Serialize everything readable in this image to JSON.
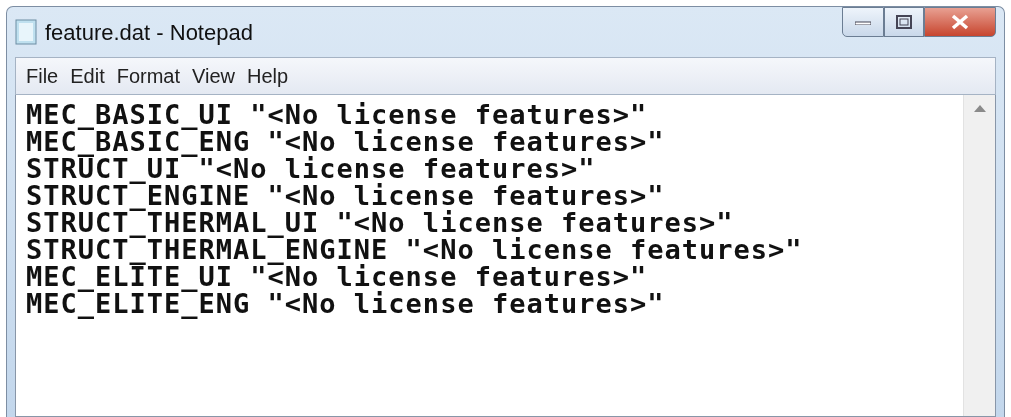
{
  "window": {
    "title": "feature.dat - Notepad"
  },
  "menu": [
    "File",
    "Edit",
    "Format",
    "View",
    "Help"
  ],
  "editor": {
    "lines": [
      "MEC_BASIC_UI \"<No license features>\"",
      "MEC_BASIC_ENG \"<No license features>\"",
      "STRUCT_UI \"<No license features>\"",
      "STRUCT_ENGINE \"<No license features>\"",
      "STRUCT_THERMAL_UI \"<No license features>\"",
      "STRUCT_THERMAL_ENGINE \"<No license features>\"",
      "MEC_ELITE_UI \"<No license features>\"",
      "MEC_ELITE_ENG \"<No license features>\""
    ]
  }
}
